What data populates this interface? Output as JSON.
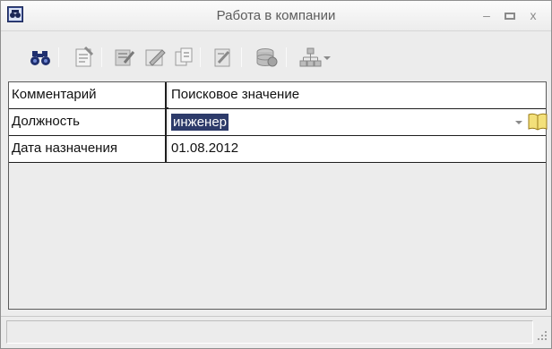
{
  "window": {
    "title": "Работа в компании",
    "min_glyph": "–",
    "close_glyph": "x"
  },
  "toolbar": {
    "icons": [
      "binoculars-icon",
      "properties-icon",
      "edit-icon",
      "pen-icon",
      "copy-icon",
      "report-icon",
      "database-icon",
      "hierarchy-icon"
    ]
  },
  "grid": {
    "header": {
      "col1": "Комментарий",
      "col2": "Поисковое значение"
    },
    "rows": [
      {
        "label": "Должность",
        "value": "инженер"
      },
      {
        "label": "Дата назначения",
        "value": "01.08.2012"
      }
    ]
  },
  "colors": {
    "selection": "#2d3b6a",
    "grid_line": "#1e1e1e",
    "window_bg": "#ececec"
  }
}
